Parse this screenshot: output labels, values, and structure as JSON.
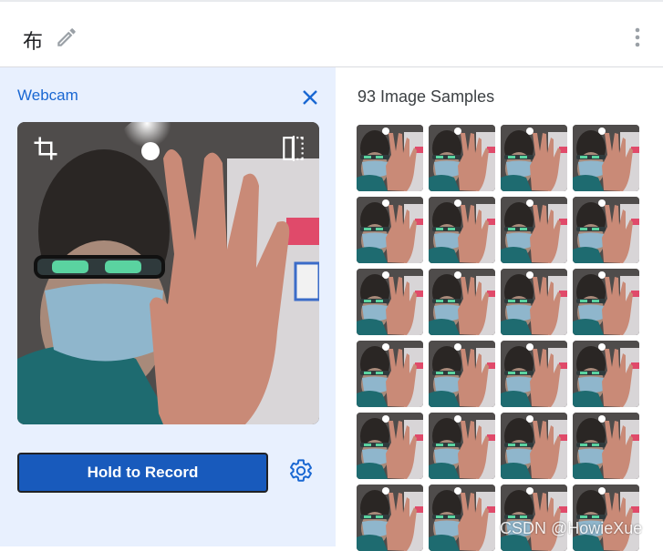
{
  "header": {
    "class_name": "布",
    "edit_icon": "pencil-icon",
    "menu_icon": "more-vert-icon"
  },
  "webcam": {
    "title": "Webcam",
    "close_icon": "close-icon",
    "crop_icon": "crop-icon",
    "flip_icon": "flip-icon",
    "record_label": "Hold to Record",
    "settings_icon": "gear-icon"
  },
  "samples": {
    "count_label": "93 Image Samples",
    "visible_rows": 6,
    "columns": 4
  },
  "watermark": "CSDN @HowieXue",
  "colors": {
    "accent": "#1967d2",
    "button_bg": "#185abc",
    "panel_bg": "#e8f0fe"
  }
}
